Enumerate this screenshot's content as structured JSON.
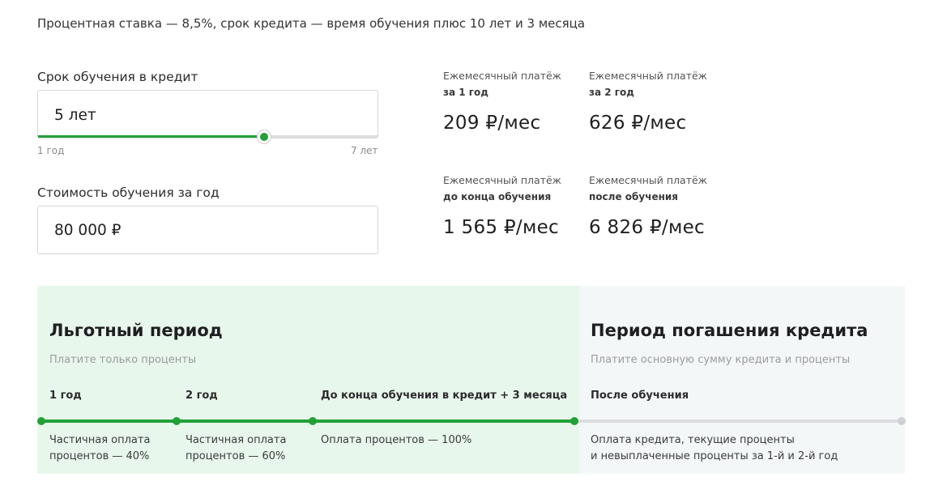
{
  "intro": "Процентная ставка — 8,5%, срок кредита — время обучения плюс 10 лет и 3 месяца",
  "term": {
    "label": "Срок обучения в кредит",
    "value": "5 лет",
    "min_label": "1 год",
    "max_label": "7 лет",
    "slider_fraction": 0.667
  },
  "cost": {
    "label": "Стоимость обучения за год",
    "value": "80 000 ₽"
  },
  "payments": [
    {
      "caption": "Ежемесячный платёж",
      "sub": "за 1 год",
      "amount": "209 ₽/мес"
    },
    {
      "caption": "Ежемесячный платёж",
      "sub": "за 2 год",
      "amount": "626 ₽/мес"
    },
    {
      "caption": "Ежемесячный платёж",
      "sub": "до конца обучения",
      "amount": "1 565 ₽/мес"
    },
    {
      "caption": "Ежемесячный платёж",
      "sub": "после обучения",
      "amount": "6 826 ₽/мес"
    }
  ],
  "grace": {
    "title": "Льготный период",
    "subtitle": "Платите только проценты",
    "stages": [
      {
        "title": "1 год",
        "desc_line1": "Частичная оплата",
        "desc_line2": "процентов — 40%"
      },
      {
        "title": "2 год",
        "desc_line1": "Частичная оплата",
        "desc_line2": "процентов — 60%"
      },
      {
        "title": "До конца обучения в кредит + 3 месяца",
        "desc_line1": "Оплата процентов — 100%",
        "desc_line2": ""
      }
    ]
  },
  "repayment": {
    "title": "Период погашения кредита",
    "subtitle": "Платите основную сумму кредита и проценты",
    "stage": {
      "title": "После обучения",
      "desc_line1": "Оплата кредита, текущие проценты",
      "desc_line2": "и невыплаченные проценты за 1-й и 2-й год"
    }
  },
  "colors": {
    "accent": "#21a038",
    "grace_bg": "#e8f7eb",
    "repayment_bg": "#f4f7f8"
  }
}
